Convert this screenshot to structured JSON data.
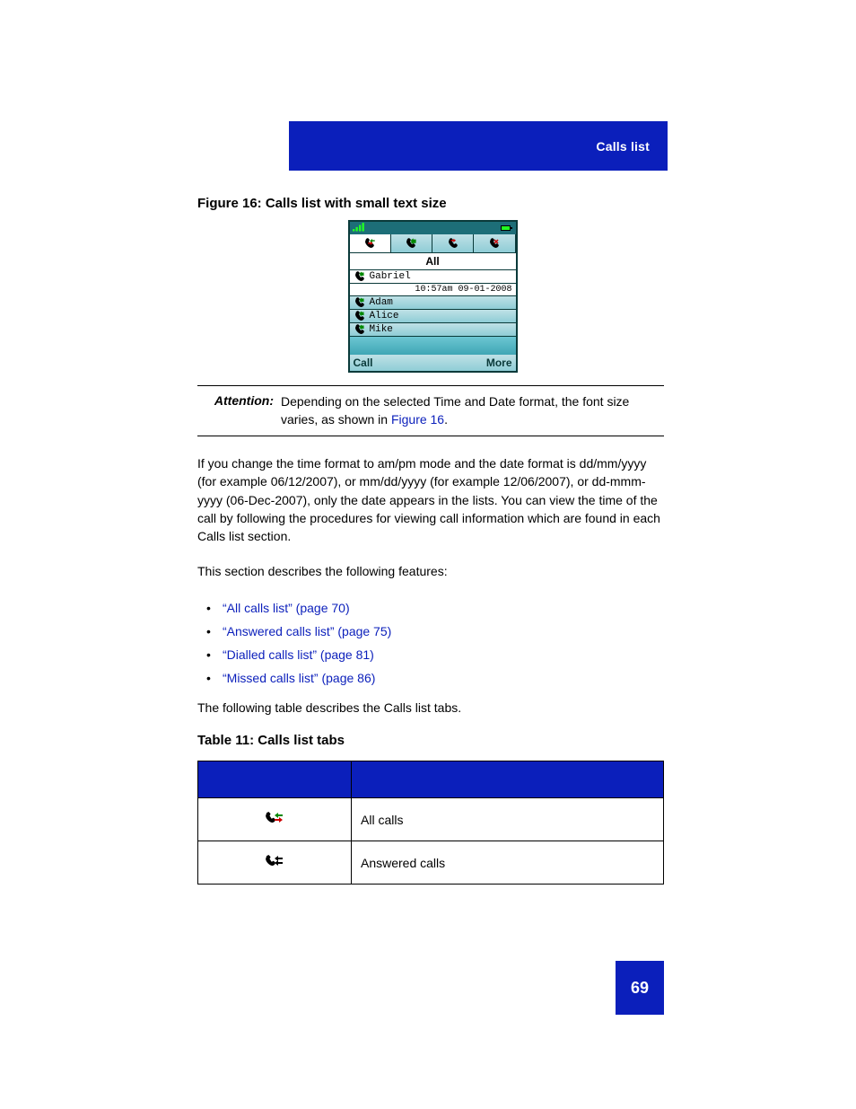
{
  "header": {
    "section": "Calls list"
  },
  "figure": {
    "caption": "Figure 16: Calls list with small text size",
    "tab_label": "All",
    "entries": [
      {
        "name": "Gabriel",
        "detail": "10:57am  09-01-2008"
      },
      {
        "name": "Adam"
      },
      {
        "name": "Alice"
      },
      {
        "name": "Mike"
      }
    ],
    "softkeys": {
      "left": "Call",
      "right": "More"
    }
  },
  "attention": {
    "label": "Attention:",
    "text_pre": "Depending on the selected Time and Date format, the font size varies, as shown in ",
    "link": "Figure 16",
    "text_post": "."
  },
  "para1": "If you change the time format to am/pm mode and the date format is dd/mm/yyyy (for example 06/12/2007), or mm/dd/yyyy (for example 12/06/2007), or dd-mmm-yyyy (06-Dec-2007), only the date appears in the lists. You can view the time of the call by following the procedures for viewing call information which are found in each Calls list section.",
  "para2": "This section describes the following features:",
  "features": [
    "“All calls list” (page 70)",
    "“Answered calls list” (page 75)",
    "“Dialled calls list” (page 81)",
    "“Missed calls list” (page 86)"
  ],
  "para3": "The following table describes the Calls list tabs.",
  "table": {
    "caption": "Table 11: Calls list tabs",
    "rows": [
      {
        "desc": "All calls",
        "icon": "all"
      },
      {
        "desc": "Answered calls",
        "icon": "answered"
      }
    ]
  },
  "page_number": "69"
}
